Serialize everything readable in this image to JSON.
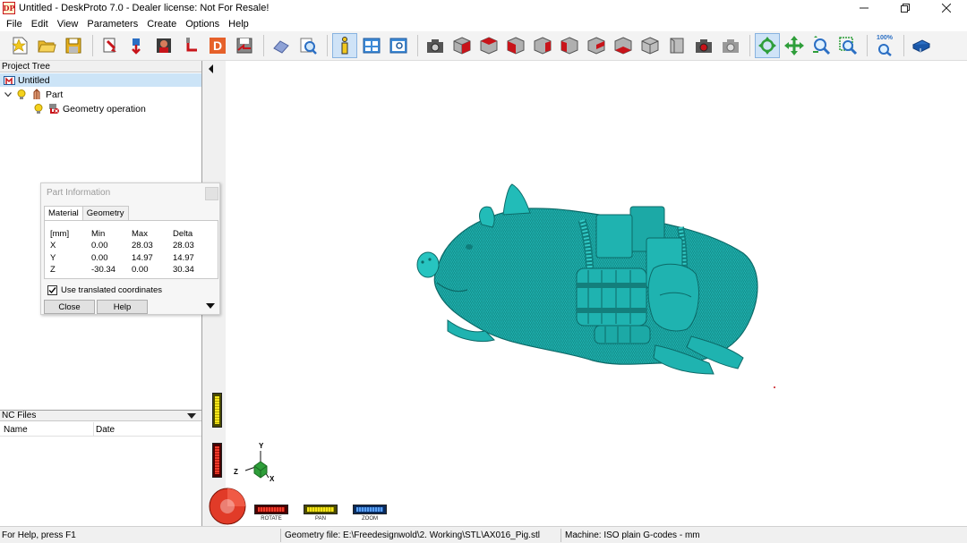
{
  "window": {
    "title": "Untitled - DeskProto 7.0 - Dealer license: Not For Resale!",
    "icon_text": "DP"
  },
  "menu": [
    "File",
    "Edit",
    "View",
    "Parameters",
    "Create",
    "Options",
    "Help"
  ],
  "toolbar": {
    "zoom_percent": "100%"
  },
  "project_tree": {
    "header": "Project Tree",
    "items": [
      {
        "label": "Untitled"
      },
      {
        "label": "Part"
      },
      {
        "label": "Geometry operation"
      }
    ]
  },
  "nc_files": {
    "header": "NC Files",
    "columns": [
      "Name",
      "Date"
    ]
  },
  "part_info": {
    "title": "Part Information",
    "tabs": [
      "Material",
      "Geometry"
    ],
    "headers": [
      "[mm]",
      "Min",
      "Max",
      "Delta"
    ],
    "rows": [
      {
        "axis": "X",
        "min": "0.00",
        "max": "28.03",
        "delta": "28.03"
      },
      {
        "axis": "Y",
        "min": "0.00",
        "max": "14.97",
        "delta": "14.97"
      },
      {
        "axis": "Z",
        "min": "-30.34",
        "max": "0.00",
        "delta": "30.34"
      }
    ],
    "checkbox_label": "Use translated coordinates",
    "checkbox_checked": true,
    "close_label": "Close",
    "help_label": "Help"
  },
  "axes": {
    "x": "X",
    "y": "Y",
    "z": "Z"
  },
  "view_controls": {
    "rotate": "ROTATE",
    "pan": "PAN",
    "zoom": "ZOOM"
  },
  "status": {
    "help": "For Help, press F1",
    "geometry": "Geometry file: E:\\Freedesignwold\\2. Working\\STL\\AX016_Pig.stl",
    "machine": "Machine: ISO plain G-codes - mm"
  },
  "colors": {
    "model": "#1fb3b0",
    "model_shade": "#0f7d7b",
    "accent_red": "#c8141a",
    "selection": "#cce4f7"
  }
}
